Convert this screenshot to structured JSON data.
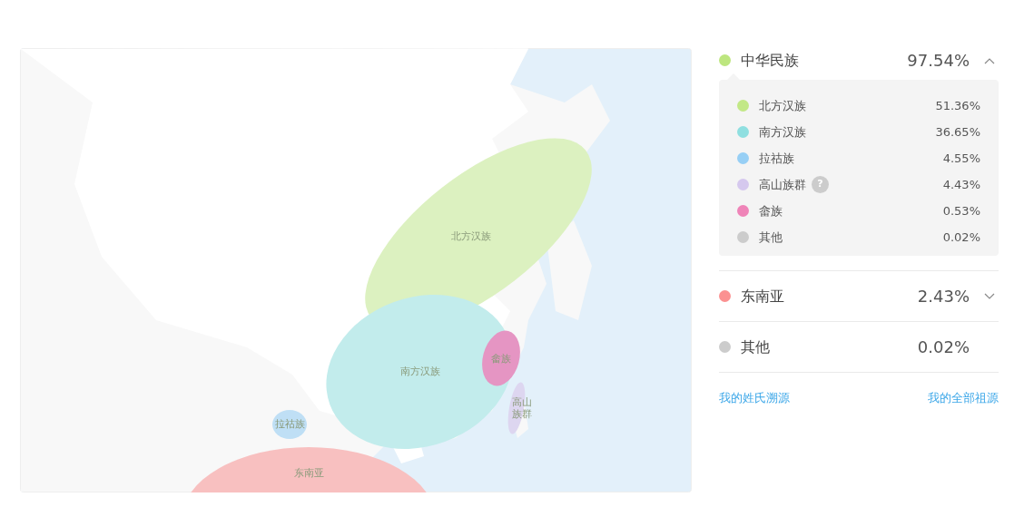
{
  "map": {
    "regions": [
      {
        "label": "北方汉族",
        "color": "#dcf1c0"
      },
      {
        "label": "南方汉族",
        "color": "#c2ecec"
      },
      {
        "label": "畲族",
        "color": "#e595c3"
      },
      {
        "label": "高山族群",
        "color": "#ddd6f0"
      },
      {
        "label": "拉祜族",
        "color": "#bfdff5"
      },
      {
        "label": "东南亚",
        "color": "#f8c0c0"
      }
    ]
  },
  "groups": [
    {
      "kind": "group",
      "name": "中华民族",
      "percent": "97.54%",
      "color": "#bde67f",
      "expanded": true,
      "children": [
        {
          "name": "北方汉族",
          "percent": "51.36%",
          "color": "#c2e886"
        },
        {
          "name": "南方汉族",
          "percent": "36.65%",
          "color": "#8fdfe0"
        },
        {
          "name": "拉祜族",
          "percent": "4.55%",
          "color": "#97cff5"
        },
        {
          "name": "高山族群",
          "percent": "4.43%",
          "color": "#d5c8ee",
          "help": "?"
        },
        {
          "name": "畲族",
          "percent": "0.53%",
          "color": "#ef84b8"
        },
        {
          "name": "其他",
          "percent": "0.02%",
          "color": "#cccccc"
        }
      ]
    },
    {
      "kind": "group",
      "name": "东南亚",
      "percent": "2.43%",
      "color": "#fb9191",
      "expanded": false
    },
    {
      "kind": "single",
      "name": "其他",
      "percent": "0.02%",
      "color": "#cccccc"
    }
  ],
  "links": [
    "我的姓氏溯源",
    "我的全部祖源"
  ]
}
